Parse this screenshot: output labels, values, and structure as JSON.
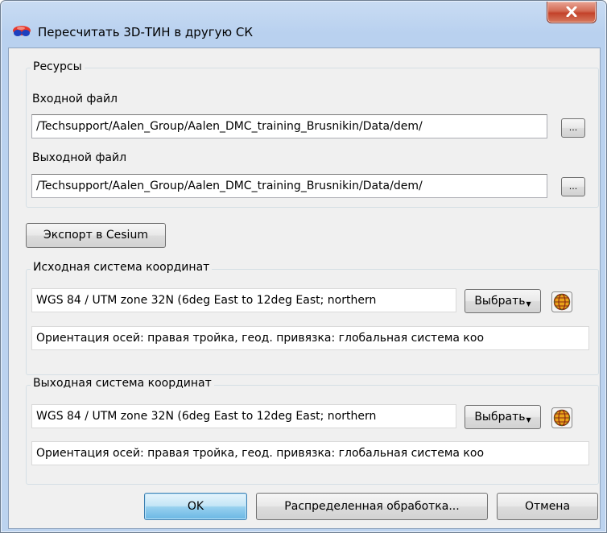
{
  "window": {
    "title": "Пересчитать 3D-ТИН в другую СК"
  },
  "resources": {
    "group_title": "Ресурсы",
    "input_label": "Входной файл",
    "input_value": "/Techsupport/Aalen_Group/Aalen_DMC_training_Brusnikin/Data/dem/",
    "output_label": "Выходной файл",
    "output_value": "/Techsupport/Aalen_Group/Aalen_DMC_training_Brusnikin/Data/dem/",
    "browse_label": "..."
  },
  "export_cesium_label": "Экспорт в Cesium",
  "source_cs": {
    "group_title": "Исходная система координат",
    "value": "WGS 84 / UTM zone 32N (6deg East to 12deg East; northern",
    "select_label": "Выбрать",
    "orientation": "Ориентация осей: правая тройка, геод. привязка: глобальная система коо"
  },
  "target_cs": {
    "group_title": "Выходная система координат",
    "value": "WGS 84 / UTM zone 32N (6deg East to 12deg East; northern",
    "select_label": "Выбрать",
    "orientation": "Ориентация осей: правая тройка, геод. привязка: глобальная система коо"
  },
  "buttons": {
    "ok": "OK",
    "distributed": "Распределенная обработка...",
    "cancel": "Отмена"
  },
  "icons": [
    "app-3d-glasses-icon",
    "close-icon",
    "globe-icon"
  ]
}
